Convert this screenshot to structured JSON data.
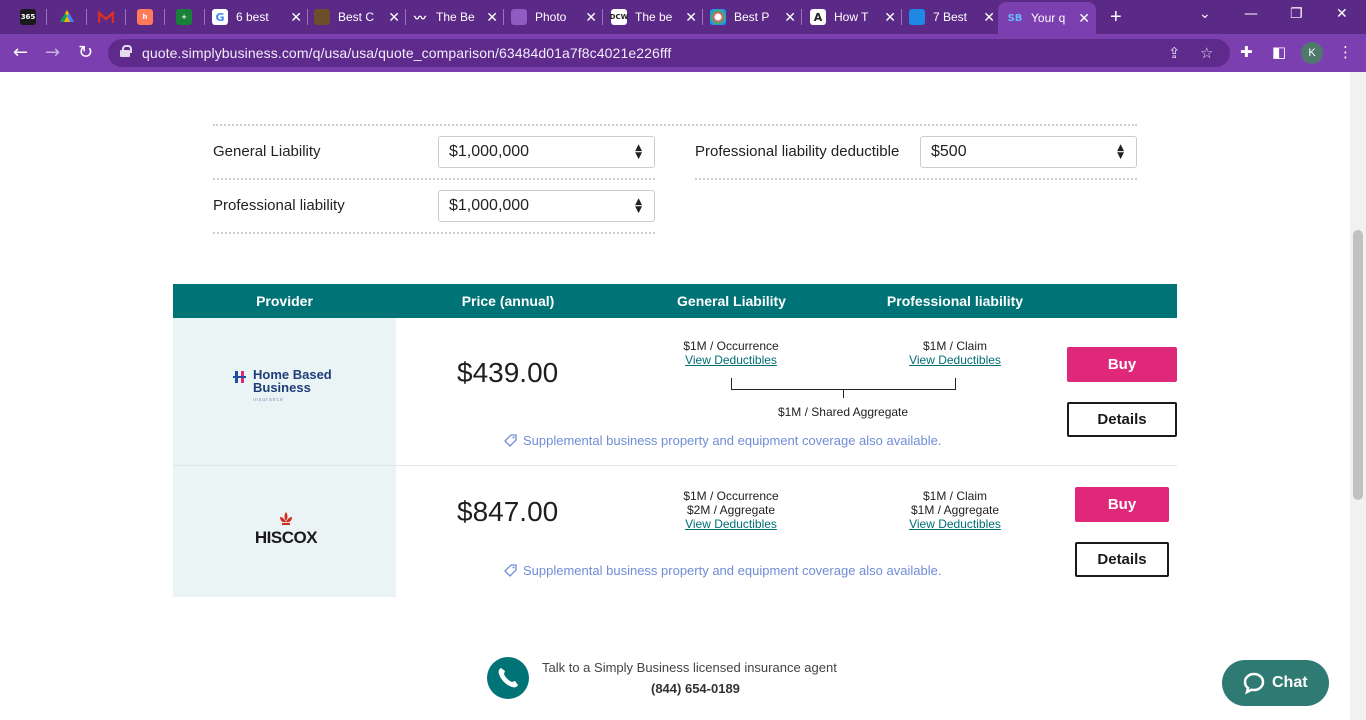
{
  "browser": {
    "tabs": [
      {
        "favicon": "365",
        "title": "",
        "color": "#1a1a1a"
      },
      {
        "favicon": "drive-icon",
        "title": "",
        "color": "#f4b400"
      },
      {
        "favicon": "gmail-icon",
        "title": "",
        "color": "#d93025"
      },
      {
        "favicon": "hubspot-icon",
        "title": "",
        "color": "#ff7a59"
      },
      {
        "favicon": "sheets-icon",
        "title": "",
        "color": "#188038"
      },
      {
        "favicon": "google-icon",
        "title": "6 best",
        "color": "#ffffff"
      },
      {
        "favicon": "site-icon",
        "title": "Best C",
        "color": "#6b4f2a"
      },
      {
        "favicon": "site-icon",
        "title": "The Be",
        "color": "#222222"
      },
      {
        "favicon": "site-icon",
        "title": "Photo",
        "color": "#7b3fb0"
      },
      {
        "favicon": "dcw-icon",
        "title": "The be",
        "color": "#ffffff"
      },
      {
        "favicon": "site-icon",
        "title": "Best P",
        "color": "#e94e77"
      },
      {
        "favicon": "site-icon",
        "title": "How T",
        "color": "#ffffff"
      },
      {
        "favicon": "site-icon",
        "title": "7 Best",
        "color": "#1e88e5"
      },
      {
        "favicon": "sb-icon",
        "title": "Your q",
        "color": "#7b3fb0"
      }
    ],
    "url": "quote.simplybusiness.com/q/usa/usa/quote_comparison/63484d01a7f8c4021e226fff",
    "profile_initial": "K"
  },
  "filters": {
    "general_liability": {
      "label": "General Liability",
      "value": "$1,000,000"
    },
    "professional_liability": {
      "label": "Professional liability",
      "value": "$1,000,000"
    },
    "professional_deductible": {
      "label": "Professional liability deductible",
      "value": "$500"
    }
  },
  "table": {
    "headers": [
      "Provider",
      "Price (annual)",
      "General Liability",
      "Professional liability"
    ],
    "rows": [
      {
        "provider": "Home Based Business",
        "provider_tagline": "insurance",
        "price": "$439.00",
        "gl_lines": [
          "$1M / Occurrence"
        ],
        "pl_lines": [
          "$1M / Claim"
        ],
        "shared": "$1M / Shared Aggregate",
        "view_deductibles": "View Deductibles",
        "supplemental": "Supplemental business property and equipment coverage also available.",
        "buy": "Buy",
        "details": "Details"
      },
      {
        "provider": "HISCOX",
        "price": "$847.00",
        "gl_lines": [
          "$1M / Occurrence",
          "$2M / Aggregate"
        ],
        "pl_lines": [
          "$1M / Claim",
          "$1M / Aggregate"
        ],
        "view_deductibles": "View Deductibles",
        "supplemental": "Supplemental business property and equipment coverage also available.",
        "buy": "Buy",
        "details": "Details"
      }
    ]
  },
  "agent": {
    "text": "Talk to a Simply Business licensed insurance agent",
    "phone": "(844) 654-0189"
  },
  "chat": {
    "label": "Chat"
  },
  "colors": {
    "teal": "#007377",
    "buy_pink": "#e0287b",
    "link_teal": "#006f73",
    "chrome_purple": "#7b3fb0"
  }
}
